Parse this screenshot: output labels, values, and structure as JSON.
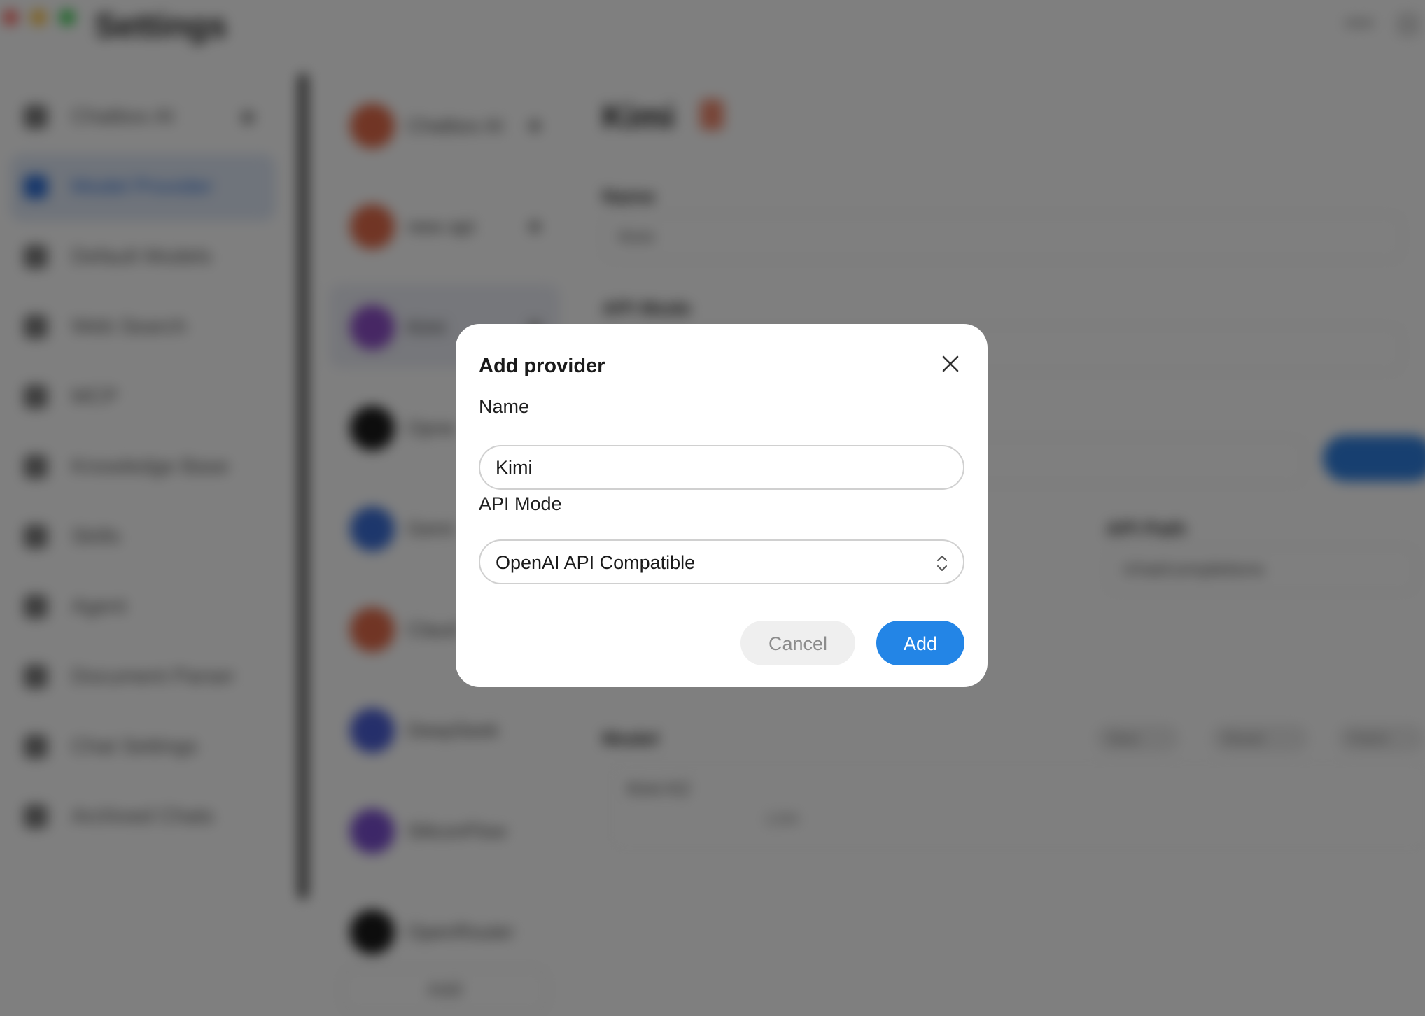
{
  "window": {
    "title": "Settings"
  },
  "sidebar": {
    "items": [
      {
        "label": "Chatbox AI",
        "icon": "chatbox-icon"
      },
      {
        "label": "Model Provider",
        "icon": "model-provider-icon",
        "active": true
      },
      {
        "label": "Default Models",
        "icon": "default-models-icon"
      },
      {
        "label": "Web Search",
        "icon": "web-search-icon"
      },
      {
        "label": "MCP",
        "icon": "mcp-icon"
      },
      {
        "label": "Knowledge Base",
        "icon": "knowledge-base-icon"
      },
      {
        "label": "Skills",
        "icon": "skills-icon"
      },
      {
        "label": "Agent",
        "icon": "agent-icon"
      },
      {
        "label": "Document Parser",
        "icon": "document-parser-icon"
      },
      {
        "label": "Chat Settings",
        "icon": "chat-settings-icon"
      },
      {
        "label": "Archived Chats",
        "icon": "archived-chats-icon"
      }
    ]
  },
  "providers": {
    "items": [
      {
        "name": "Chatbox AI",
        "color": "#e36b4a"
      },
      {
        "name": "new api",
        "color": "#e36b4a"
      },
      {
        "name": "Kimi",
        "color": "#8e4fc9",
        "selected": true
      },
      {
        "name": "Opne",
        "color": "#1a1a1a"
      },
      {
        "name": "Gemi",
        "color": "#3b6fd8"
      },
      {
        "name": "Claud",
        "color": "#e36b4a"
      },
      {
        "name": "DeepSeek",
        "color": "#4b5fd6"
      },
      {
        "name": "SiliconFlow",
        "color": "#7b4fd0"
      },
      {
        "name": "OpenRouter",
        "color": "#1a1a1a"
      }
    ],
    "add_label": "Add"
  },
  "detail": {
    "title": "Kimi",
    "name_label": "Name",
    "name_value": "Kimi",
    "api_mode_label": "API Mode",
    "api_path_label": "API Path",
    "api_path_value": "/chat/completions",
    "models_label": "Model",
    "model_actions": [
      "New",
      "Reset",
      "Fetch"
    ],
    "model_item": "Kimi K2",
    "model_meta": "128K"
  },
  "modal": {
    "title": "Add provider",
    "name_label": "Name",
    "name_value": "Kimi",
    "api_mode_label": "API Mode",
    "api_mode_value": "OpenAI API Compatible",
    "cancel_label": "Cancel",
    "add_label": "Add"
  },
  "colors": {
    "accent": "#2385e6",
    "scrim": "rgba(0,0,0,0.5)",
    "cancel_bg": "#efefef",
    "cancel_text": "#8c8c8c"
  }
}
